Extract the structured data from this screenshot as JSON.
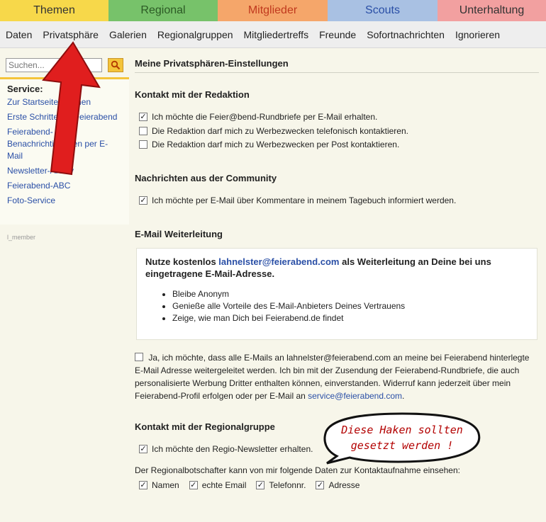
{
  "top_nav": [
    {
      "label": "Themen",
      "bg": "#f7d84a",
      "color": "#333333"
    },
    {
      "label": "Regional",
      "bg": "#77c26a",
      "color": "#2c5a25"
    },
    {
      "label": "Mitglieder",
      "bg": "#f5a66a",
      "color": "#c0391e"
    },
    {
      "label": "Scouts",
      "bg": "#a9c1e3",
      "color": "#2a4fa6"
    },
    {
      "label": "Unterhaltung",
      "bg": "#f2a0a0",
      "color": "#333333"
    }
  ],
  "sub_nav": [
    "Daten",
    "Privatsphäre",
    "Galerien",
    "Regionalgruppen",
    "Mitgliedertreffs",
    "Freunde",
    "Sofortnachrichten",
    "Ignorieren"
  ],
  "sidebar": {
    "search_placeholder": "Suchen...",
    "service_title": "Service:",
    "links": [
      "Zur Startseite machen",
      "Erste Schritte bei Feierabend",
      "Feierabend-Benachrichtigungen per E-Mail",
      "Newsletter-Archiv",
      "Feierabend-ABC",
      "Foto-Service"
    ],
    "member_label": "l_member"
  },
  "main": {
    "title": "Meine Privatsphären-Einstellungen",
    "sections": {
      "kontakt_redaktion": {
        "title": "Kontakt mit der Redaktion",
        "options": [
          {
            "label": "Ich möchte die Feier@bend-Rundbriefe per E-Mail erhalten.",
            "checked": true
          },
          {
            "label": "Die Redaktion darf mich zu Werbezwecken telefonisch kontaktieren.",
            "checked": false
          },
          {
            "label": "Die Redaktion darf mich zu Werbezwecken per Post kontaktieren.",
            "checked": false
          }
        ]
      },
      "community": {
        "title": "Nachrichten aus der Community",
        "options": [
          {
            "label": "Ich möchte per E-Mail über Kommentare in meinem Tagebuch informiert werden.",
            "checked": true
          }
        ]
      },
      "email_weiterleitung": {
        "title": "E-Mail Weiterleitung",
        "promo_prefix": "Nutze kostenlos ",
        "promo_email": "lahnelster@feierabend.com",
        "promo_suffix": " als Weiterleitung an Deine bei uns eingetragene E-Mail-Adresse.",
        "bullets": [
          "Bleibe Anonym",
          "Genieße alle Vorteile des E-Mail-Anbieters Deines Vertrauens",
          "Zeige, wie man Dich bei Feierabend.de findet"
        ],
        "forward_text": "Ja, ich möchte, dass alle E-Mails an lahnelster@feierabend.com an meine bei Feierabend hinterlegte E-Mail Adresse weitergeleitet werden. Ich bin mit der Zusendung der Feierabend-Rundbriefe, die auch personalisierte Werbung Dritter enthalten können, einverstanden. Widerruf kann jederzeit über mein Feierabend-Profil erfolgen oder per E-Mail an ",
        "forward_link": "service@feierabend.com",
        "forward_end": ".",
        "forward_checked": false
      },
      "regionalgruppe": {
        "title": "Kontakt mit der Regionalgruppe",
        "options": [
          {
            "label": "Ich möchte den Regio-Newsletter erhalten.",
            "checked": true
          }
        ],
        "info": "Der Regionalbotschafter kann von mir folgende Daten zur Kontaktaufnahme einsehen:",
        "multi": [
          {
            "label": "Namen",
            "checked": true
          },
          {
            "label": "echte Email",
            "checked": true
          },
          {
            "label": "Telefonnr.",
            "checked": true
          },
          {
            "label": "Adresse",
            "checked": true
          }
        ]
      }
    }
  },
  "annotation": {
    "line1": "Diese Haken sollten",
    "line2": "gesetzt werden !"
  }
}
